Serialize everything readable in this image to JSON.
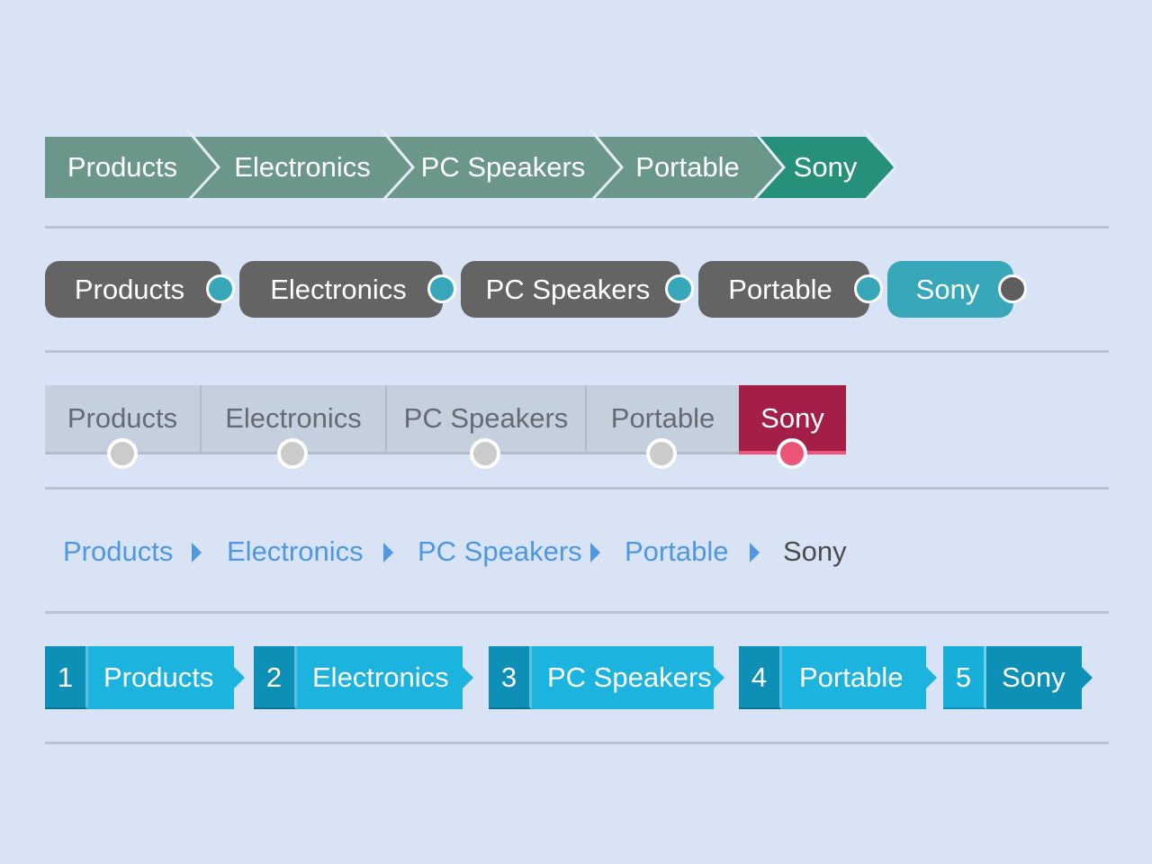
{
  "breadcrumb_items": [
    "Products",
    "Electronics",
    "PC Speakers",
    "Portable"
  ],
  "current_item": "Sony",
  "numbers": [
    "1",
    "2",
    "3",
    "4",
    "5"
  ],
  "colors": {
    "background": "#d8e4f6",
    "arrow_inactive": "#6b978a",
    "arrow_active": "#26907a",
    "pill_inactive": "#646464",
    "pill_active": "#38a7b9",
    "tab_inactive": "#c5d0df",
    "tab_active": "#a31f47",
    "tab_active_dot": "#ec5577",
    "link": "#4f98e1",
    "numbered": "#1cb4de",
    "numbered_active": "#0d8fb6"
  }
}
